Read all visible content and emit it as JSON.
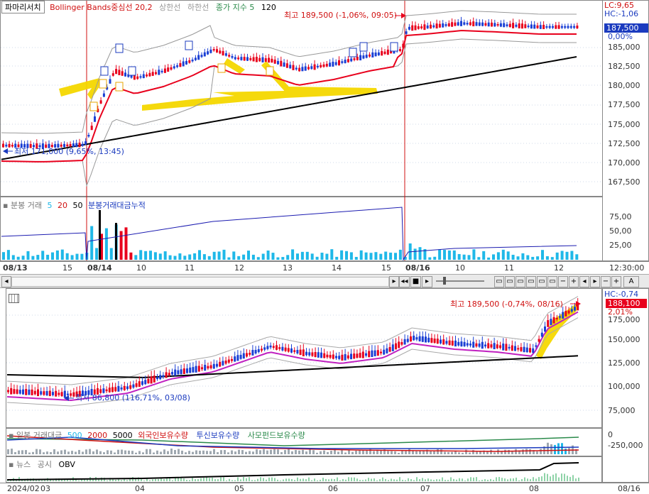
{
  "top": {
    "indicator_tabs": {
      "tab1": "파마리서치",
      "tab2": "Bollinger Bands중심선 20,2",
      "tab3": "상한선",
      "tab4": "하한선",
      "tab5": "종가 지수 5",
      "tab6": "120"
    },
    "lc_label": "LC:9,65",
    "hc_label": "HC:-1,06",
    "current_price": "187,500",
    "current_change": "0,00%",
    "max_note": "최고 189,500 (-1,06%, 09:05)",
    "min_note": "최저 171,000 (9,65%, 13:45)",
    "price_ticks": [
      "185,000",
      "182,500",
      "180,000",
      "177,500",
      "175,000",
      "172,500",
      "170,000",
      "167,500"
    ],
    "volume_legend": {
      "title": "분봉 거래",
      "v5": "5",
      "v20": "20",
      "v50": "50",
      "cum": "분봉거래대금누적"
    },
    "volume_ticks": [
      "75,00",
      "50,00",
      "25,00"
    ],
    "time_labels": [
      "08/13",
      "15",
      "08/14",
      "10",
      "11",
      "12",
      "13",
      "14",
      "15",
      "08/16",
      "10",
      "11",
      "12"
    ],
    "time_right": "12:30:00"
  },
  "bottom": {
    "hc_label": "HC:-0,74",
    "current_price": "188,100",
    "current_change": "2,01%",
    "max_note": "최고 189,500 (-0,74%, 08/16)",
    "min_note": "최저 86,800 (116,71%, 03/08)",
    "price_ticks": [
      "175,000",
      "150,000",
      "125,000",
      "100,000",
      "75,000"
    ],
    "flow_legend": {
      "title": "일봉 거래대금",
      "v500": "500",
      "v2000": "2000",
      "v5000": "5000",
      "foreign": "외국인보유수량",
      "trust": "투신보유수량",
      "fund": "사모펀드보유수량"
    },
    "flow_ticks": [
      "0",
      "-250,000"
    ],
    "news_legend": {
      "news": "뉴스",
      "notice": "공시",
      "obv": "OBV"
    },
    "date_labels": [
      "2024/02",
      "03",
      "04",
      "05",
      "06",
      "07",
      "08"
    ],
    "date_right": "08/16"
  },
  "toolbar": {
    "auto": "A"
  },
  "colors": {
    "up": "#e8001c",
    "down": "#1a3fd4",
    "ma_red": "#e8001c",
    "ma_black": "#000000",
    "band": "#888888",
    "highlight": "#f5d800",
    "vol_cyan": "#1fb8e8",
    "accent_blue": "#1b3bbf"
  }
}
